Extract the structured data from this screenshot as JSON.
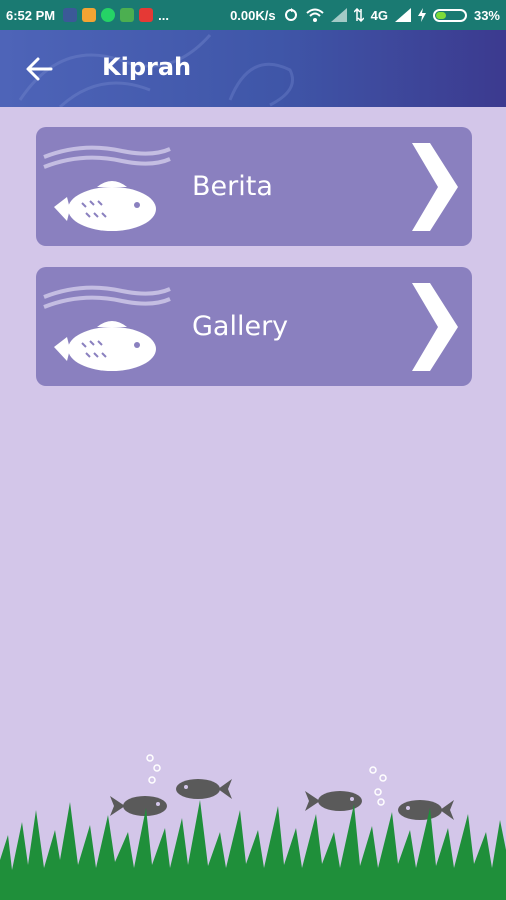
{
  "status_bar": {
    "time": "6:52 PM",
    "app_icons": [
      {
        "name": "facebook-icon",
        "color": "#3b5998",
        "glyph": "f"
      },
      {
        "name": "app-icon",
        "color": "#f4a433",
        "glyph": "a"
      },
      {
        "name": "whatsapp-icon",
        "color": "#25d366",
        "glyph": "w"
      },
      {
        "name": "messages-icon",
        "color": "#4caf50",
        "glyph": "m"
      },
      {
        "name": "notification-icon",
        "color": "#e53935",
        "glyph": "q"
      }
    ],
    "more": "...",
    "network_speed": "0.00K/s",
    "network_type": "4G",
    "battery": "33%"
  },
  "appbar": {
    "title": "Kiprah"
  },
  "menu": [
    {
      "label": "Berita"
    },
    {
      "label": "Gallery"
    }
  ],
  "colors": {
    "background": "#d3c6e9",
    "card": "#8a80bf",
    "appbar": "#4e64b8",
    "statusbar": "#1a7a72",
    "grass": "#1f8f3a",
    "fish": "#5a5a5a"
  }
}
